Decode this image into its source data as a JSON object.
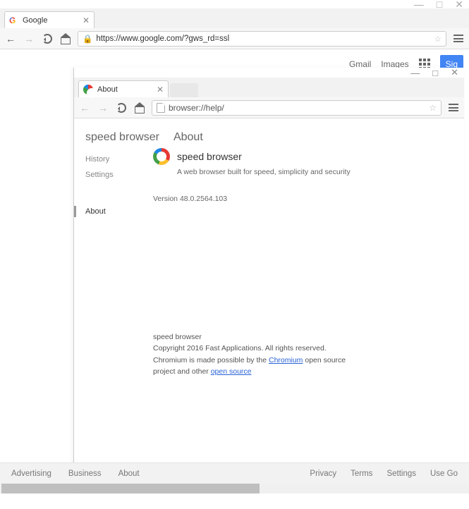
{
  "outer_window": {
    "min": "—",
    "max": "□",
    "close": "✕"
  },
  "outer_tab": {
    "title": "Google",
    "close": "✕"
  },
  "outer_toolbar": {
    "url": "https://www.google.com/?gws_rd=ssl",
    "back": "←",
    "fwd": "→"
  },
  "google_nav": {
    "gmail": "Gmail",
    "images": "Images",
    "signin": "Sig"
  },
  "about_window": {
    "min": "—",
    "max": "□",
    "close": "✕",
    "tab_title": "About",
    "tab_close": "✕",
    "url": "browser://help/"
  },
  "about_page": {
    "brand": "speed browser",
    "title": "About",
    "nav_history": "History",
    "nav_settings": "Settings",
    "nav_about": "About",
    "app_name": "speed browser",
    "app_sub": "A web browser built for speed, simplicity and security",
    "version": "Version 48.0.2564.103",
    "foot_brand": "speed browser",
    "copyright": "Copyright 2016 Fast Applications. All rights reserved.",
    "chromium_pre": "Chromium is made possible by the ",
    "chromium_link": "Chromium",
    "chromium_mid": " open source project and other ",
    "opensource_link": "open source"
  },
  "google_footer": {
    "advertising": "Advertising",
    "business": "Business",
    "about": "About",
    "privacy": "Privacy",
    "terms": "Terms",
    "settings": "Settings",
    "usegoogle": "Use Go"
  }
}
